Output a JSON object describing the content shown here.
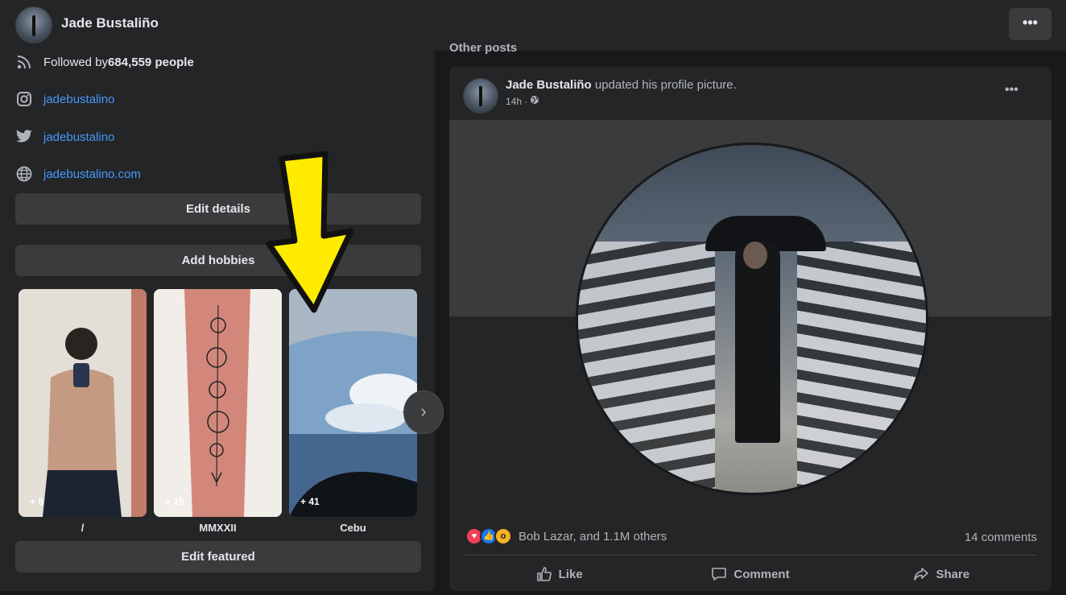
{
  "header": {
    "name": "Jade Bustaliño",
    "more_label": "•••"
  },
  "intro": {
    "followed_prefix": "Followed by ",
    "followed_count": "684,559",
    "followed_suffix": " people",
    "instagram": "jadebustalino",
    "twitter": "jadebustalino",
    "website": "jadebustalino.com",
    "edit_details": "Edit details",
    "add_hobbies": "Add hobbies",
    "edit_featured": "Edit featured"
  },
  "featured": [
    {
      "label": "/",
      "count": "+ 8"
    },
    {
      "label": "MMXXII",
      "count": "+ 15"
    },
    {
      "label": "Cebu",
      "count": "+ 41"
    }
  ],
  "other_posts_heading": "Other posts",
  "post": {
    "author": "Jade Bustaliño",
    "action": " updated his profile picture.",
    "time": "14h",
    "dot": "·",
    "more_label": "•••",
    "reactions_text": "Bob Lazar, and 1.1M others",
    "comments": "14 comments",
    "like": "Like",
    "comment": "Comment",
    "share": "Share"
  },
  "icons": {
    "rss": "rss-icon",
    "instagram": "instagram-icon",
    "twitter": "twitter-icon",
    "globe": "globe-icon",
    "next": "chevron-right-icon",
    "arrow": "yellow-arrow-annotation"
  },
  "colors": {
    "link": "#4599ff",
    "annotation_arrow": "#ffeb00"
  }
}
